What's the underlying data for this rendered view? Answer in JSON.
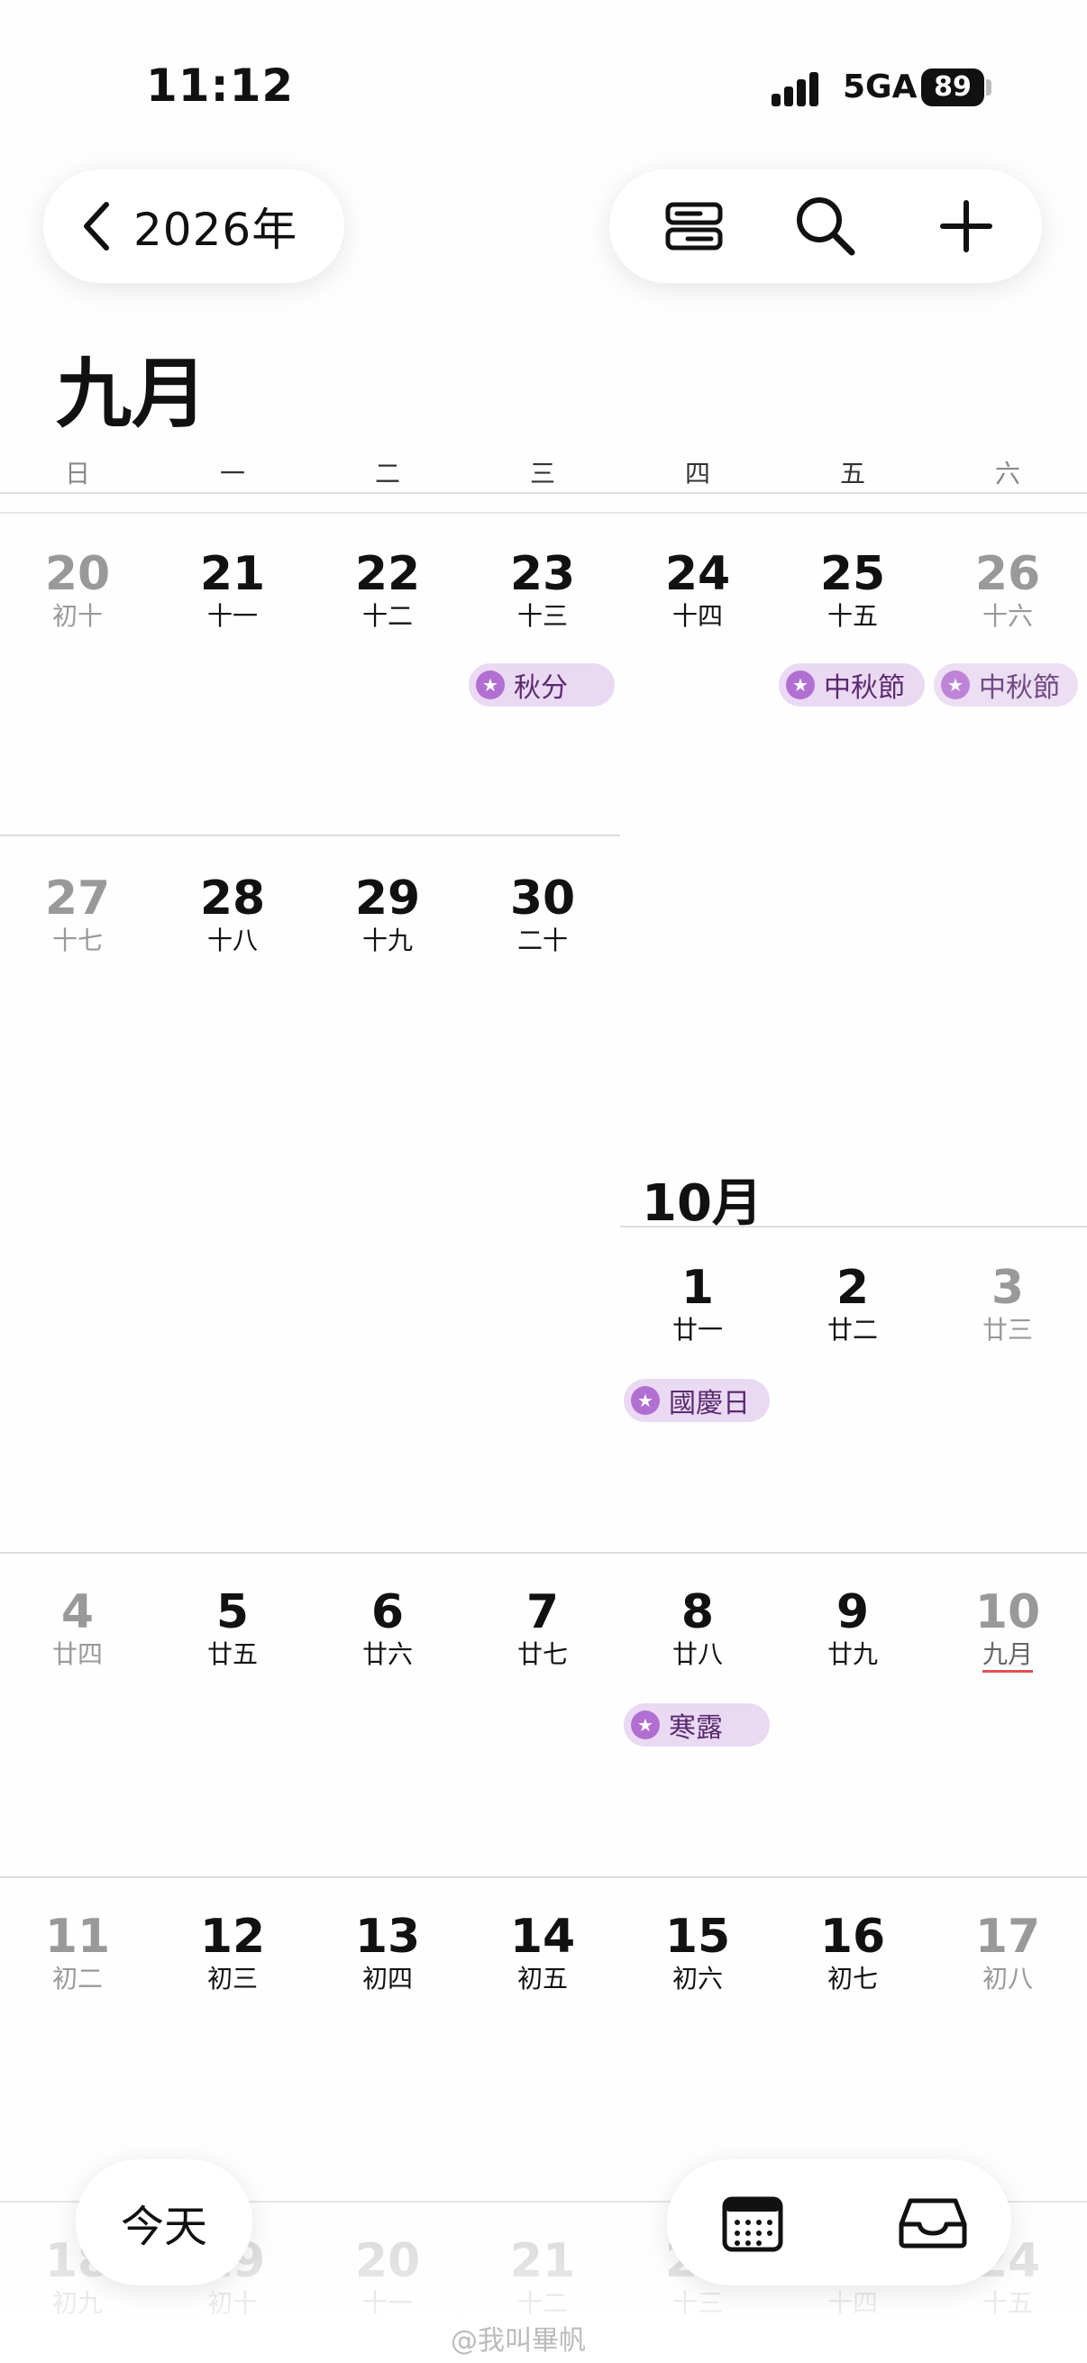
{
  "status_bar": {
    "time": "11:12",
    "network": "5GA",
    "battery": "89"
  },
  "nav": {
    "back_year": "2026年"
  },
  "month_title": "九月",
  "weekdays": [
    "日",
    "一",
    "二",
    "三",
    "四",
    "五",
    "六"
  ],
  "october_label": "10月",
  "weeks": [
    {
      "days": [
        {
          "n": "20",
          "l": "初十"
        },
        {
          "n": "21",
          "l": "十一"
        },
        {
          "n": "22",
          "l": "十二"
        },
        {
          "n": "23",
          "l": "十三"
        },
        {
          "n": "24",
          "l": "十四"
        },
        {
          "n": "25",
          "l": "十五"
        },
        {
          "n": "26",
          "l": "十六"
        }
      ]
    },
    {
      "days": [
        {
          "n": "27",
          "l": "十七"
        },
        {
          "n": "28",
          "l": "十八"
        },
        {
          "n": "29",
          "l": "十九"
        },
        {
          "n": "30",
          "l": "二十"
        }
      ]
    },
    {
      "days": [
        {
          "n": "1",
          "l": "廿一"
        },
        {
          "n": "2",
          "l": "廿二"
        },
        {
          "n": "3",
          "l": "廿三"
        }
      ]
    },
    {
      "days": [
        {
          "n": "4",
          "l": "廿四"
        },
        {
          "n": "5",
          "l": "廿五"
        },
        {
          "n": "6",
          "l": "廿六"
        },
        {
          "n": "7",
          "l": "廿七"
        },
        {
          "n": "8",
          "l": "廿八"
        },
        {
          "n": "9",
          "l": "廿九"
        },
        {
          "n": "10",
          "l": "九月"
        }
      ]
    },
    {
      "days": [
        {
          "n": "11",
          "l": "初二"
        },
        {
          "n": "12",
          "l": "初三"
        },
        {
          "n": "13",
          "l": "初四"
        },
        {
          "n": "14",
          "l": "初五"
        },
        {
          "n": "15",
          "l": "初六"
        },
        {
          "n": "16",
          "l": "初七"
        },
        {
          "n": "17",
          "l": "初八"
        }
      ]
    },
    {
      "days": [
        {
          "n": "18",
          "l": "初九"
        },
        {
          "n": "19",
          "l": "初十"
        },
        {
          "n": "20",
          "l": "十一"
        },
        {
          "n": "21",
          "l": "十二"
        },
        {
          "n": "22",
          "l": "十三"
        },
        {
          "n": "23",
          "l": "十四"
        },
        {
          "n": "24",
          "l": "十五"
        }
      ]
    }
  ],
  "events": {
    "autumn_equinox": "秋分",
    "mid_autumn_1": "中秋節",
    "mid_autumn_2": "中秋節",
    "national_day": "國慶日",
    "cold_dew": "寒露"
  },
  "bottom": {
    "today_label": "今天"
  },
  "watermark": "@我叫畢帆",
  "colors": {
    "event_bg": "#ead9f2",
    "event_star": "#b26fd2",
    "lunar_month_underline": "#e05050"
  },
  "icons": [
    "chevron-left-icon",
    "list-view-icon",
    "search-icon",
    "plus-icon",
    "calendar-icon",
    "inbox-icon",
    "star-icon"
  ]
}
